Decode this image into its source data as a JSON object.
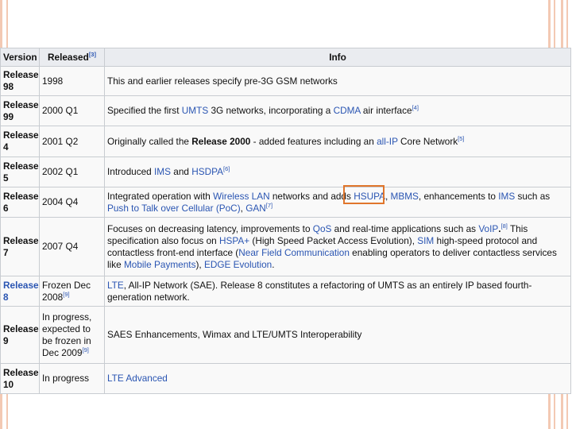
{
  "table": {
    "headers": {
      "version": "Version",
      "released": "Released",
      "released_ref": "[3]",
      "info": "Info"
    },
    "rows": [
      {
        "version": "Release 98",
        "released": "1998",
        "info": [
          {
            "t": "This and earlier releases specify pre-3G GSM networks"
          }
        ]
      },
      {
        "version": "Release 99",
        "released": "2000 Q1",
        "info": [
          {
            "t": "Specified the first "
          },
          {
            "t": "UMTS",
            "link": true
          },
          {
            "t": " 3G networks, incorporating a "
          },
          {
            "t": "CDMA",
            "link": true
          },
          {
            "t": " air interface"
          },
          {
            "t": "[4]",
            "ref": true
          }
        ]
      },
      {
        "version": "Release 4",
        "released": "2001 Q2",
        "info": [
          {
            "t": "Originally called the "
          },
          {
            "t": "Release 2000",
            "bold": true
          },
          {
            "t": " - added features including an "
          },
          {
            "t": "all-IP",
            "link": true
          },
          {
            "t": " Core Network"
          },
          {
            "t": "[5]",
            "ref": true
          }
        ]
      },
      {
        "version": "Release 5",
        "released": "2002 Q1",
        "info": [
          {
            "t": "Introduced "
          },
          {
            "t": "IMS",
            "link": true
          },
          {
            "t": " and "
          },
          {
            "t": "HSDPA",
            "link": true
          },
          {
            "t": "[6]",
            "ref": true
          }
        ]
      },
      {
        "version": "Release 6",
        "released": "2004 Q4",
        "info": [
          {
            "t": "Integrated operation with "
          },
          {
            "t": "Wireless LAN",
            "link": true
          },
          {
            "t": " networks and adds "
          },
          {
            "t": "HSUPA",
            "link": true
          },
          {
            "t": ", "
          },
          {
            "t": "MBMS",
            "link": true
          },
          {
            "t": ", enhancements to "
          },
          {
            "t": "IMS",
            "link": true
          },
          {
            "t": " such as "
          },
          {
            "t": "Push to Talk over Cellular (PoC)",
            "link": true
          },
          {
            "t": ", "
          },
          {
            "t": "GAN",
            "link": true
          },
          {
            "t": "[7]",
            "ref": true
          }
        ]
      },
      {
        "version": "Release 7",
        "released": "2007 Q4",
        "info": [
          {
            "t": "Focuses on decreasing latency, improvements to "
          },
          {
            "t": "QoS",
            "link": true
          },
          {
            "t": " and real-time applications such as "
          },
          {
            "t": "VoIP",
            "link": true
          },
          {
            "t": ".",
            "bold": true
          },
          {
            "t": "[8]",
            "ref": true
          },
          {
            "t": " This specification also focus on "
          },
          {
            "t": "HSPA+",
            "link": true
          },
          {
            "t": " (High Speed Packet Access Evolution), "
          },
          {
            "t": "SIM",
            "link": true
          },
          {
            "t": " high-speed protocol and contactless front-end interface ("
          },
          {
            "t": "Near Field Communication",
            "link": true
          },
          {
            "t": " enabling operators to deliver contactless services like "
          },
          {
            "t": "Mobile Payments",
            "link": true
          },
          {
            "t": "), "
          },
          {
            "t": "EDGE Evolution",
            "link": true
          },
          {
            "t": "."
          }
        ]
      },
      {
        "version": "Release 8",
        "version_link": true,
        "released": "Frozen Dec 2008",
        "released_ref": "[9]",
        "info": [
          {
            "t": "LTE",
            "link": true
          },
          {
            "t": ", All-IP Network (SAE). Release 8 constitutes a refactoring of UMTS as an entirely IP based fourth-generation network."
          }
        ]
      },
      {
        "version": "Release 9",
        "released": "In progress, expected to be frozen in Dec 2009",
        "released_ref": "[9]",
        "info": [
          {
            "t": "SAES Enhancements, Wimax and LTE/UMTS Interoperability"
          }
        ]
      },
      {
        "version": "Release 10",
        "released": "In progress",
        "info": [
          {
            "t": "LTE Advanced",
            "link": true
          }
        ]
      }
    ]
  },
  "highlight": {
    "color": "#e0762c",
    "target": "HSUPA"
  },
  "colors": {
    "link": "#2a55b2",
    "header_bg": "#eaecf0",
    "cell_bg": "#f9f9f9",
    "border": "#c8ccd1",
    "decor_stripes": "#f3c9b3"
  }
}
